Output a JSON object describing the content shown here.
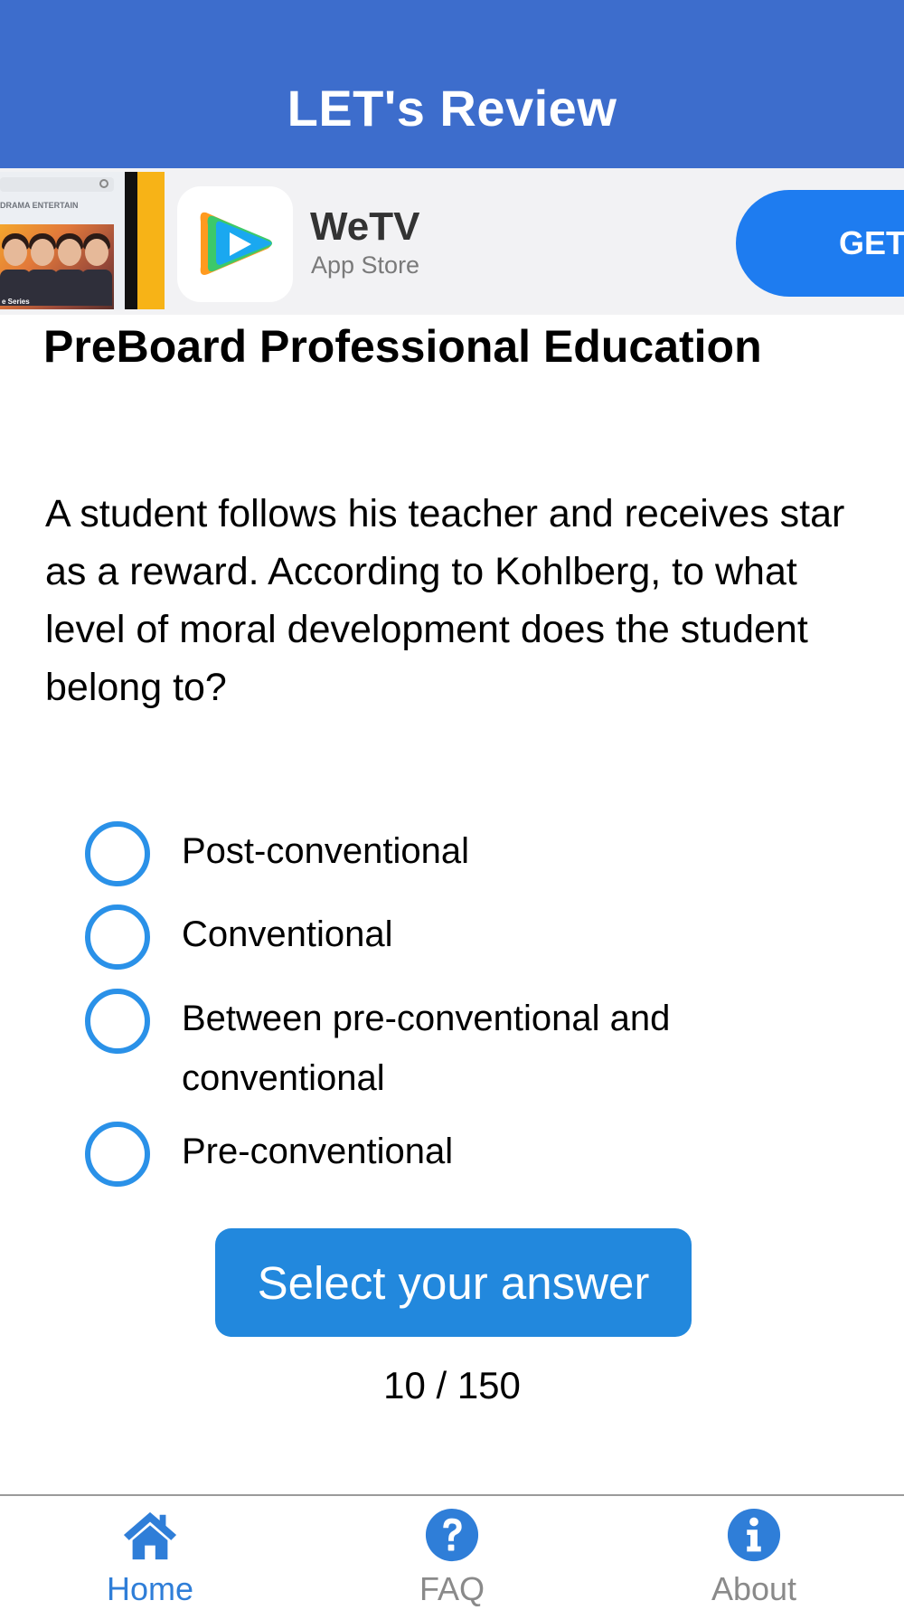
{
  "header": {
    "title": "LET's Review",
    "background_color": "#3d6dcc"
  },
  "ad": {
    "thumbnail_categories": "DRAMA  ENTERTAIN",
    "thumbnail_caption": "e Series",
    "app_name": "WeTV",
    "store": "App Store",
    "cta_label": "GET",
    "cta_color": "#1e7cf0"
  },
  "quiz": {
    "title": "PreBoard Professional Education",
    "question": "A student follows his teacher and receives star as a reward. According to Kohlberg, to what level of moral development does the student belong to?",
    "options": [
      {
        "label": "Post-conventional",
        "selected": false
      },
      {
        "label": "Conventional",
        "selected": false
      },
      {
        "label": "Between pre-conventional and conventional",
        "selected": false
      },
      {
        "label": "Pre-conventional",
        "selected": false
      }
    ],
    "answer_button_label": "Select your answer",
    "progress": "10 / 150",
    "accent_color": "#2a91e8"
  },
  "tabbar": {
    "active_color": "#2f7ed8",
    "inactive_color": "#8a8a8a",
    "tabs": [
      {
        "label": "Home",
        "icon": "home-icon",
        "active": true
      },
      {
        "label": "FAQ",
        "icon": "question-circle-icon",
        "active": false
      },
      {
        "label": "About",
        "icon": "info-circle-icon",
        "active": false
      }
    ]
  }
}
